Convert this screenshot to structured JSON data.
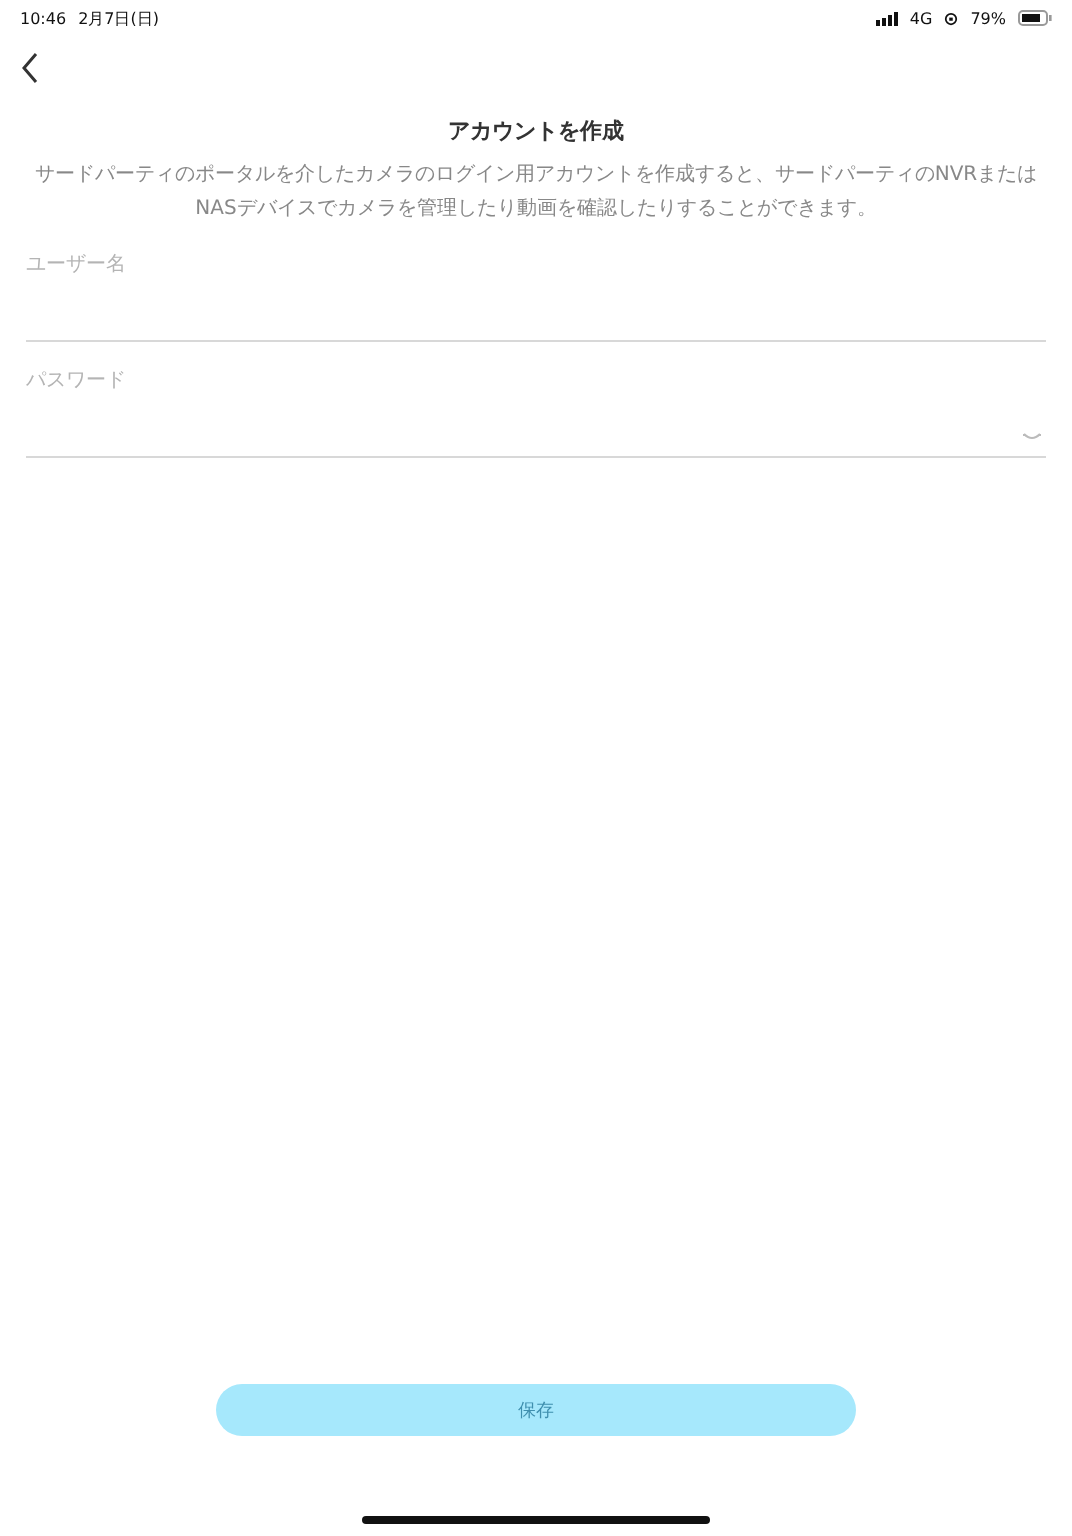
{
  "status_bar": {
    "time": "10:46",
    "date": "2月7日(日)",
    "network": "4G",
    "battery": "79%"
  },
  "title": "アカウントを作成",
  "description": "サードパーティのポータルを介したカメラのログイン用アカウントを作成すると、サードパーティのNVRまたはNASデバイスでカメラを管理したり動画を確認したりすることができます。",
  "fields": [
    {
      "kind": "text",
      "placeholder": "ユーザー名"
    },
    {
      "kind": "password",
      "placeholder": "パスワード"
    }
  ],
  "save_button": {
    "label": "保存",
    "disabled": true
  }
}
